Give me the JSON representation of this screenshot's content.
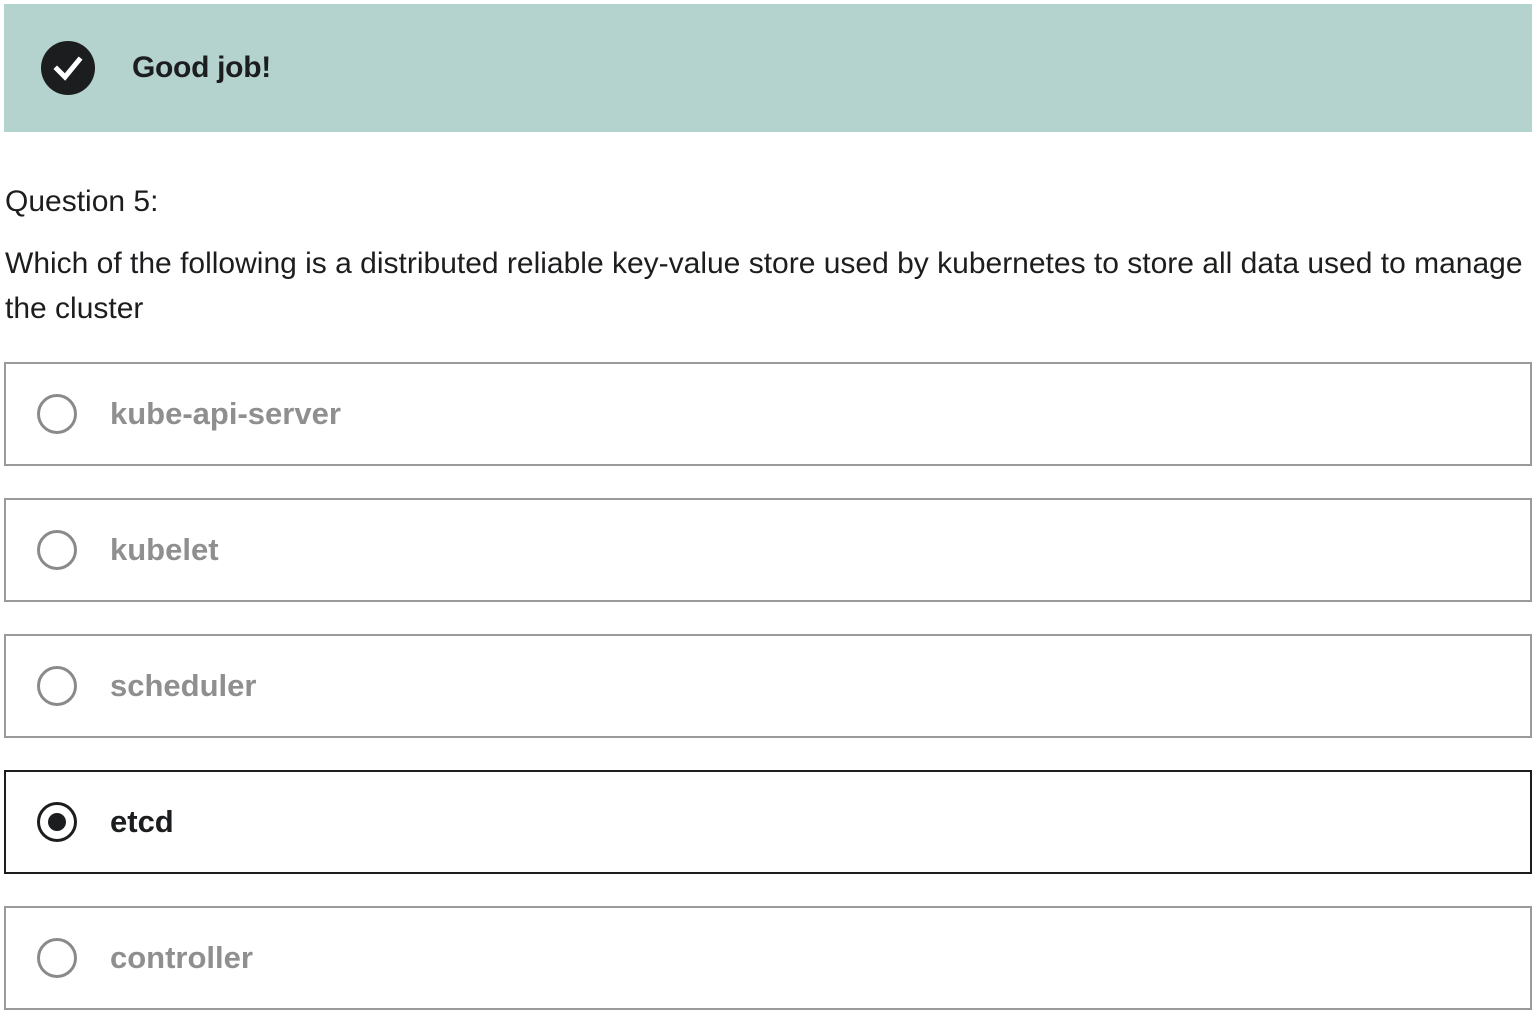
{
  "banner": {
    "message": "Good job!",
    "icon": "check-circle-icon",
    "background": "#b4d3ce"
  },
  "question": {
    "label": "Question 5:",
    "text": "Which of the following is a distributed reliable key-value store used by kubernetes to store all data used to manage the cluster"
  },
  "options": [
    {
      "label": "kube-api-server",
      "selected": false
    },
    {
      "label": "kubelet",
      "selected": false
    },
    {
      "label": "scheduler",
      "selected": false
    },
    {
      "label": "etcd",
      "selected": true
    },
    {
      "label": "controller",
      "selected": false
    }
  ],
  "colors": {
    "text": "#1c1d1f",
    "muted": "#8f8f8f",
    "border": "#9a9a9a"
  }
}
